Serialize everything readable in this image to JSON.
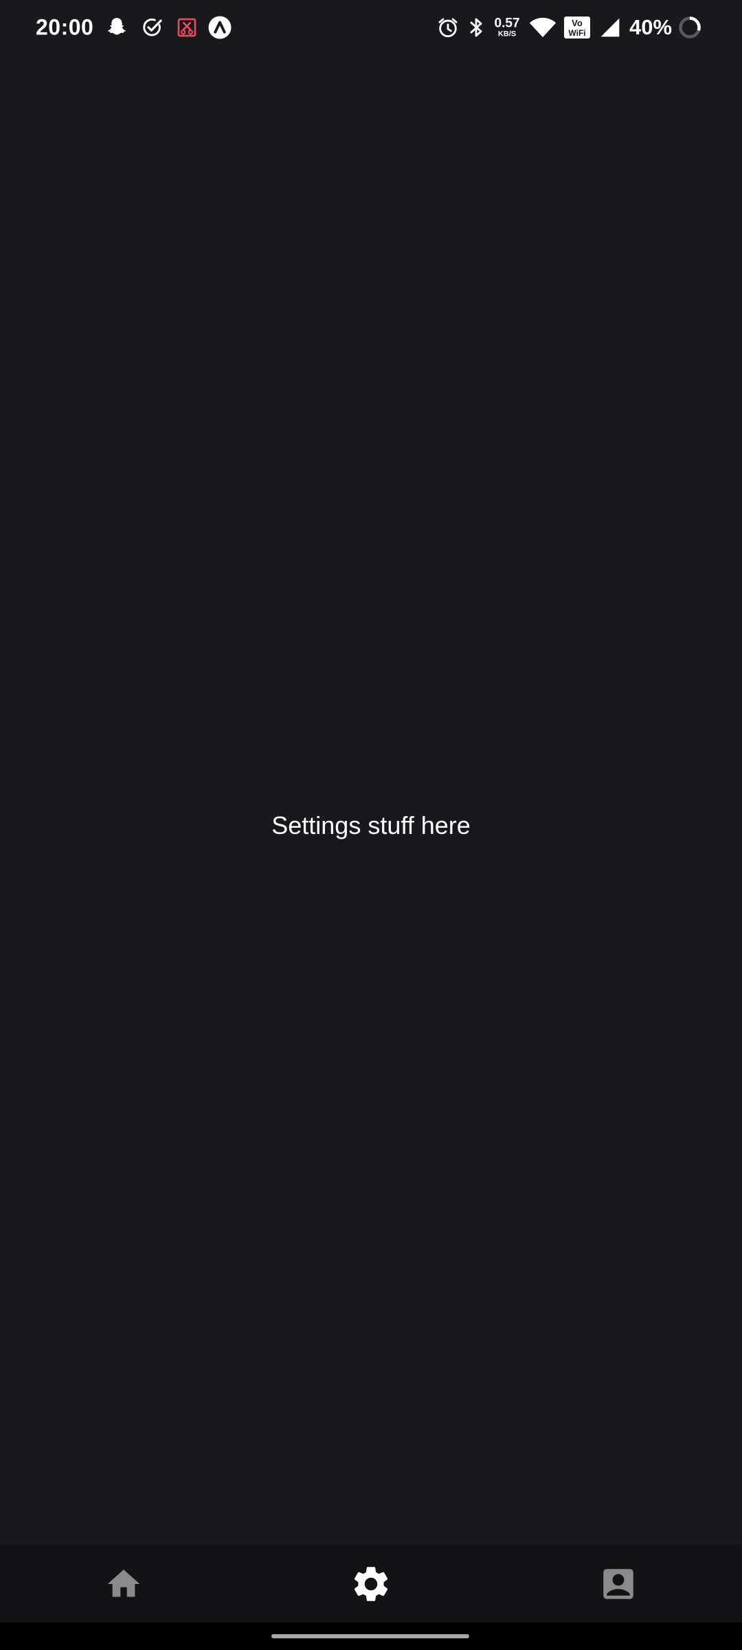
{
  "status_bar": {
    "time": "20:00",
    "left_icons": [
      "snapchat-icon",
      "check-circle-icon",
      "screenshot-blocked-icon",
      "arc-app-icon"
    ],
    "right_icons": [
      "alarm-icon",
      "bluetooth-icon",
      "wifi-icon",
      "vowifi-icon",
      "cellular-signal-icon",
      "battery-ring-icon"
    ],
    "net_speed_value": "0.57",
    "net_speed_unit": "KB/S",
    "battery_percent": "40%",
    "vowifi_top": "Vo",
    "vowifi_bottom": "WiFi",
    "accent_red": "#e84a5f"
  },
  "main": {
    "message": "Settings stuff here"
  },
  "bottom_nav": {
    "tabs": [
      {
        "name": "home",
        "icon": "home-icon",
        "active": false
      },
      {
        "name": "settings",
        "icon": "gear-icon",
        "active": true
      },
      {
        "name": "contact",
        "icon": "contact-card-icon",
        "active": false
      }
    ],
    "active_color": "#ffffff",
    "inactive_color": "#8a8a8a"
  },
  "theme": {
    "background": "#18191b",
    "nav_background": "#121314"
  }
}
